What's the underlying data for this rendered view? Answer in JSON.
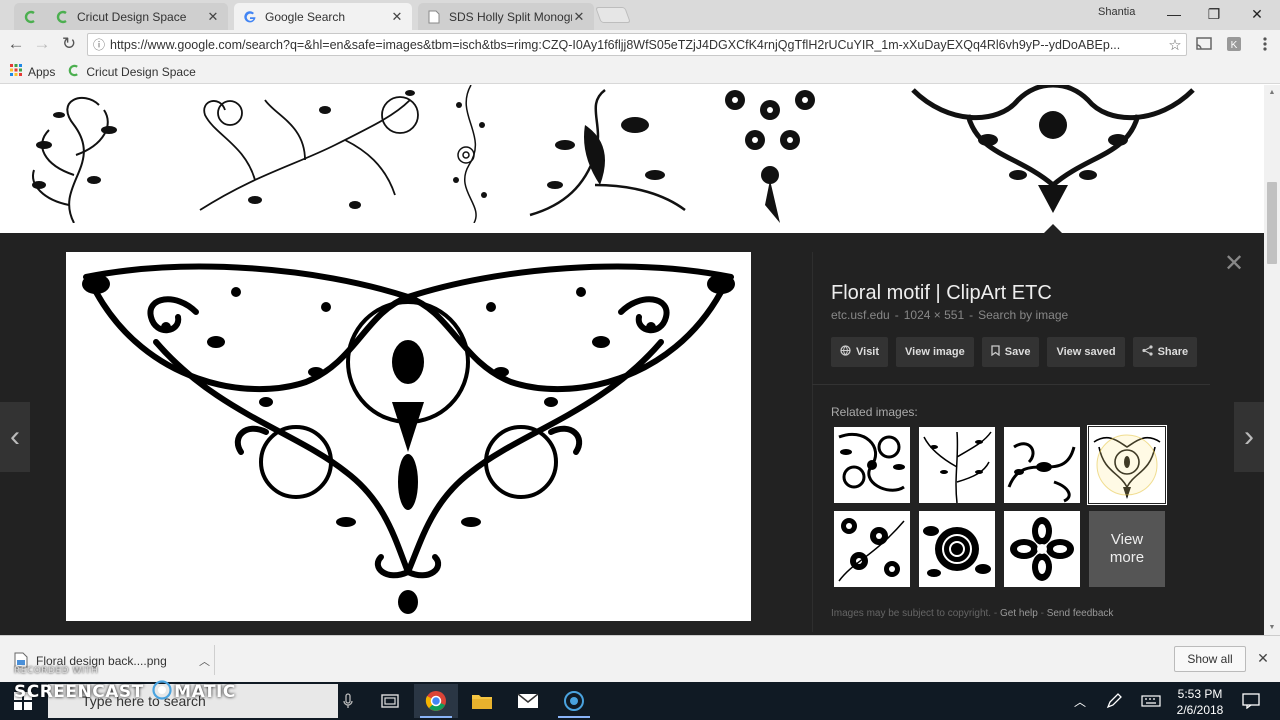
{
  "browser": {
    "tabs": [
      {
        "title": "Cricut Design Space",
        "icon": "cricut-icon",
        "active": false
      },
      {
        "title": "Google Search",
        "icon": "google-icon",
        "active": true
      },
      {
        "title": "SDS Holly Split Monogra",
        "icon": "page-icon",
        "active": false
      }
    ],
    "user_name": "Shantia",
    "url": "https://www.google.com/search?q=&hl=en&safe=images&tbm=isch&tbs=rimg:CZQ-I0Ay1f6fljj8WfS05eTZjJ4DGXCfK4rnjQgTflH2rUCuYIR_1m-xXuDayEXQq4Rl6vh9yP--ydDoABEp...",
    "bookmarks": [
      {
        "label": "Apps",
        "icon": "apps-grid-icon"
      },
      {
        "label": "Cricut Design Space",
        "icon": "cricut-icon"
      }
    ]
  },
  "preview": {
    "title": "Floral motif | ClipArt ETC",
    "source": "etc.usf.edu",
    "separator": "-",
    "dimensions": "1024 × 551",
    "search_by_image": "Search by image",
    "actions": [
      {
        "label": "Visit",
        "icon": "globe-icon"
      },
      {
        "label": "View image",
        "icon": ""
      },
      {
        "label": "Save",
        "icon": "bookmark-icon"
      },
      {
        "label": "View saved",
        "icon": ""
      },
      {
        "label": "Share",
        "icon": "share-icon"
      }
    ],
    "related_label": "Related images:",
    "view_more": "View more",
    "footer": {
      "copyright": "Images may be subject to copyright.",
      "dash": "-",
      "get_help": "Get help",
      "send_feedback": "Send feedback"
    }
  },
  "downloads": {
    "file_name": "Floral design back....png",
    "show_all": "Show all"
  },
  "taskbar": {
    "search_placeholder": "Type here to search",
    "time": "5:53 PM",
    "date": "2/6/2018"
  },
  "watermark": {
    "recorded_with": "RECORDED WITH",
    "brand_left": "SCREENCAST",
    "brand_right": "MATIC"
  },
  "colors": {
    "panel_bg": "#222222",
    "taskbar_bg": "#101a24",
    "accent": "#8ab4f8"
  }
}
